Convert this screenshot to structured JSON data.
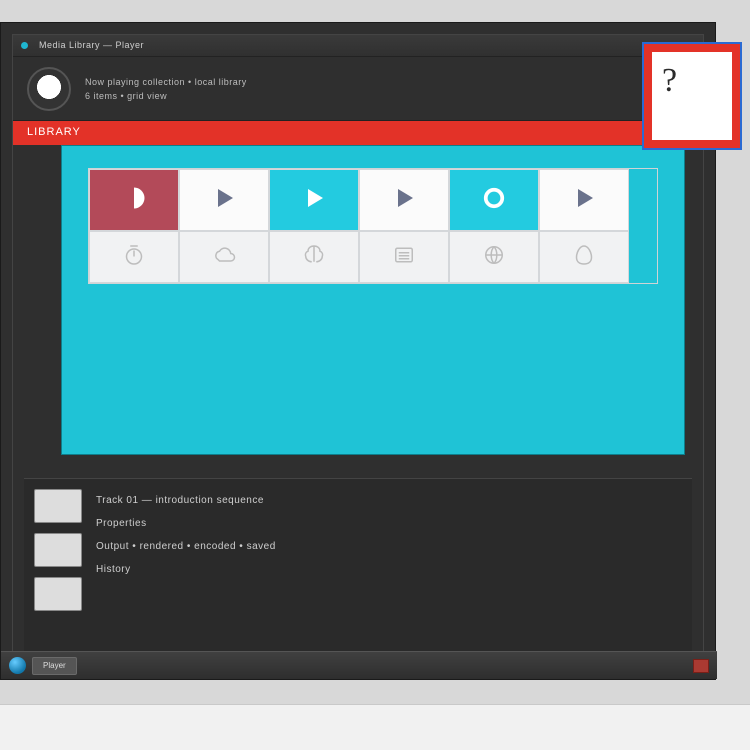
{
  "window": {
    "title": "Media Library — Player",
    "header_line1": "Now playing collection • local library",
    "header_line2": "6 items • grid view"
  },
  "redbar": {
    "label": "LIBRARY"
  },
  "corner": {
    "glyph": "?"
  },
  "tiles_top": [
    {
      "name": "item-1",
      "icon": "half-icon",
      "variant": "brand"
    },
    {
      "name": "item-2",
      "icon": "play-icon",
      "variant": ""
    },
    {
      "name": "item-3",
      "icon": "play-icon",
      "variant": "cyan"
    },
    {
      "name": "item-4",
      "icon": "play-icon",
      "variant": ""
    },
    {
      "name": "item-5",
      "icon": "ring-icon",
      "variant": "cyan"
    },
    {
      "name": "item-6",
      "icon": "play-icon",
      "variant": ""
    }
  ],
  "tiles_bottom": [
    {
      "name": "opt-1",
      "icon": "timer-icon"
    },
    {
      "name": "opt-2",
      "icon": "cloud-icon"
    },
    {
      "name": "opt-3",
      "icon": "brain-icon"
    },
    {
      "name": "opt-4",
      "icon": "list-icon"
    },
    {
      "name": "opt-5",
      "icon": "globe-icon"
    },
    {
      "name": "opt-6",
      "icon": "egg-icon"
    }
  ],
  "panel_lines": [
    "Track 01  —  introduction sequence",
    "Properties",
    "Output  •  rendered  •  encoded  •  saved",
    "History"
  ],
  "taskbar": {
    "app": "Player"
  },
  "colors": {
    "accent_red": "#e33228",
    "accent_cyan": "#1fc3d6",
    "brand": "#b34a59"
  }
}
